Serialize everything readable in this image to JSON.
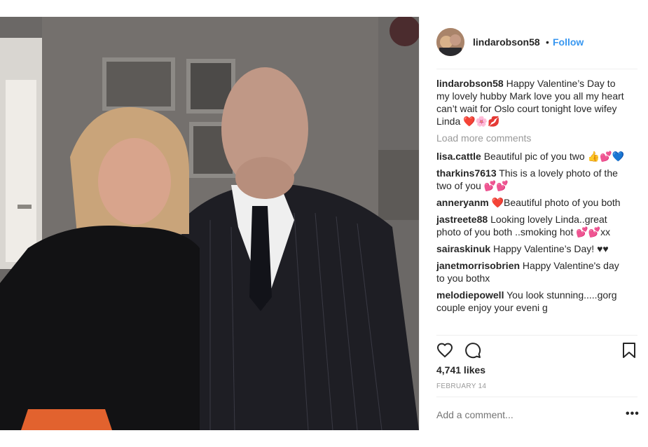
{
  "post": {
    "username": "lindarobson58",
    "separator": "•",
    "follow_label": "Follow",
    "caption": {
      "username": "lindarobson58",
      "text": "Happy Valentine’s Day to my lovely hubby Mark love you all my heart can’t wait for Oslo court tonight love wifey Linda ❤️🌸💋"
    },
    "load_more": "Load more comments",
    "comments": [
      {
        "username": "lisa.cattle",
        "text": "Beautiful pic of you two 👍💕💙"
      },
      {
        "username": "tharkins7613",
        "text": "This is a lovely photo of the two of you 💕💕"
      },
      {
        "username": "anneryanm",
        "text": "❤️Beautiful photo of you both"
      },
      {
        "username": "jastreete88",
        "text": "Looking lovely Linda..great photo of you both ..smoking hot 💕💕xx"
      },
      {
        "username": "sairaskinuk",
        "text": "Happy Valentine’s Day! ♥♥"
      },
      {
        "username": "janetmorrisobrien",
        "text": "Happy Valentine's day to you bothx"
      },
      {
        "username": "melodiepowell",
        "text": "You look stunning.....gorg couple enjoy your eveni g"
      }
    ],
    "likes": "4,741 likes",
    "date": "FEBRUARY 14",
    "add_comment_placeholder": "Add a comment...",
    "more_label": "•••",
    "icons": {
      "like": "heart-icon",
      "comment": "comment-bubble-icon",
      "save": "bookmark-icon",
      "more": "more-options-icon"
    },
    "colors": {
      "link_blue": "#3897f0",
      "text": "#262626",
      "muted": "#999999",
      "border": "#efefef"
    }
  }
}
